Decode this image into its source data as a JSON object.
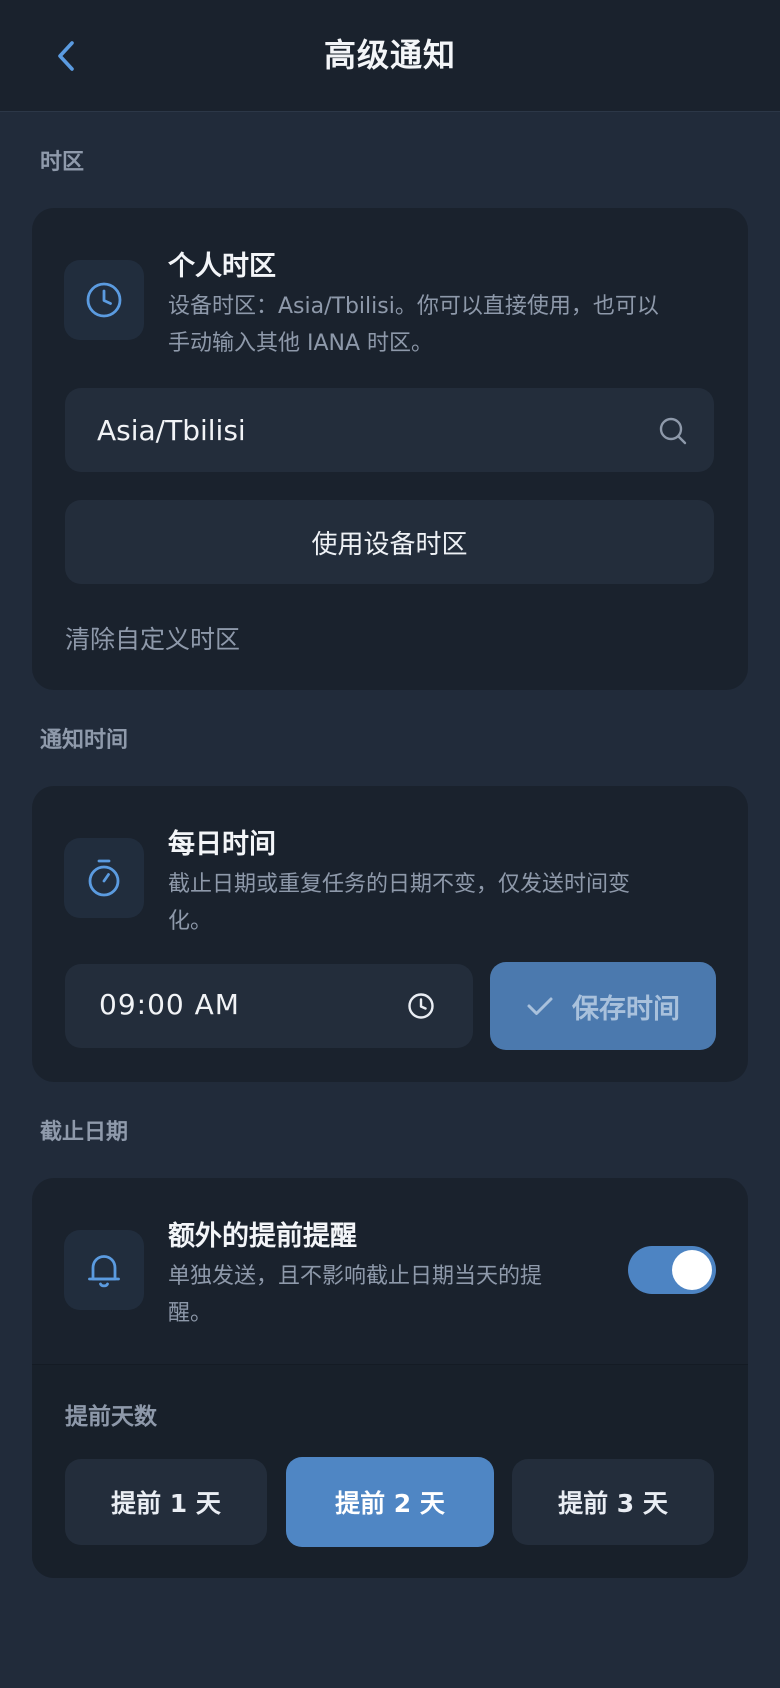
{
  "header": {
    "title": "高级通知"
  },
  "sections": {
    "timezone": "时区",
    "notify_time": "通知时间",
    "due_date": "截止日期"
  },
  "timezone_card": {
    "icon": "clock-icon",
    "title": "个人时区",
    "description_line1": "设备时区：Asia/Tbilisi。你可以直接使用，也可以",
    "description_line2": "手动输入其他 IANA 时区。",
    "input_value": "Asia/Tbilisi",
    "use_device_button": "使用设备时区",
    "clear_link": "清除自定义时区"
  },
  "daily_card": {
    "icon": "stopwatch-icon",
    "title": "每日时间",
    "description_line1": "截止日期或重复任务的日期不变，仅发送时间变",
    "description_line2": "化。",
    "time_value": "09:00 AM",
    "save_button": "保存时间"
  },
  "reminder_card": {
    "icon": "bell-icon",
    "title": "额外的提前提醒",
    "description_line1": "单独发送，且不影响截止日期当天的提",
    "description_line2": "醒。",
    "toggle_on": true,
    "days_label": "提前天数",
    "options": [
      "提前 1 天",
      "提前 2 天",
      "提前 3 天"
    ],
    "selected_option": "提前 2 天"
  },
  "colors": {
    "accent": "#4f86c4",
    "background": "#212b3a",
    "card": "#1a222d"
  }
}
